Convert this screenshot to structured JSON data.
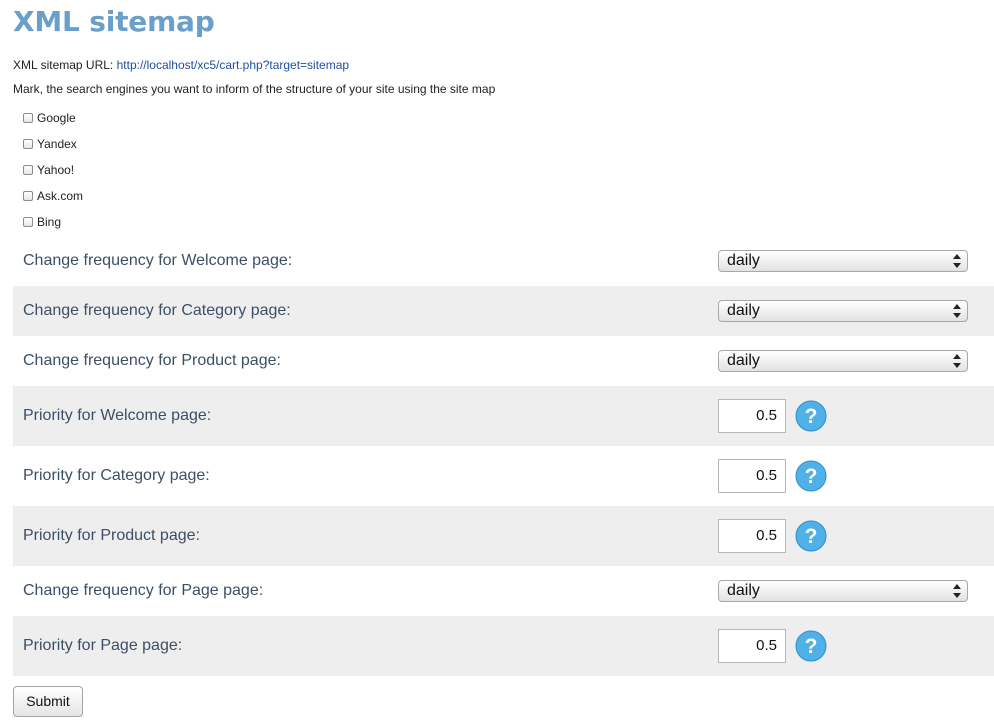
{
  "page": {
    "title": "XML sitemap"
  },
  "sitemap_url": {
    "label": "XML sitemap URL:",
    "link": "http://localhost/xc5/cart.php?target=sitemap"
  },
  "instructions": "Mark, the search engines you want to inform of the structure of your site using the site map",
  "engines": [
    {
      "label": "Google",
      "checked": false
    },
    {
      "label": "Yandex",
      "checked": false
    },
    {
      "label": "Yahoo!",
      "checked": false
    },
    {
      "label": "Ask.com",
      "checked": false
    },
    {
      "label": "Bing",
      "checked": false
    }
  ],
  "settings": [
    {
      "label": "Change frequency for Welcome page:",
      "type": "select",
      "value": "daily"
    },
    {
      "label": "Change frequency for Category page:",
      "type": "select",
      "value": "daily"
    },
    {
      "label": "Change frequency for Product page:",
      "type": "select",
      "value": "daily"
    },
    {
      "label": "Priority for Welcome page:",
      "type": "priority",
      "value": "0.5",
      "help_icon": "question-icon"
    },
    {
      "label": "Priority for Category page:",
      "type": "priority",
      "value": "0.5",
      "help_icon": "question-icon"
    },
    {
      "label": "Priority for Product page:",
      "type": "priority",
      "value": "0.5",
      "help_icon": "question-icon"
    },
    {
      "label": "Change frequency for Page page:",
      "type": "select",
      "value": "daily"
    },
    {
      "label": "Priority for Page page:",
      "type": "priority",
      "value": "0.5",
      "help_icon": "question-icon"
    }
  ],
  "submit_label": "Submit",
  "colors": {
    "title": "#6a9fc9",
    "label": "#3d4f66",
    "link": "#1f4f9c",
    "row_shade": "#eeeeee",
    "help_icon": "#4fb1e8"
  }
}
